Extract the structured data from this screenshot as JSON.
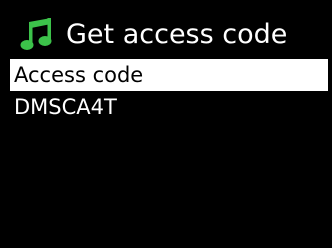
{
  "header": {
    "icon": "music-note-icon",
    "icon_color": "#3cc24a",
    "title": "Get access code"
  },
  "menu": {
    "items": [
      {
        "label": "Access code",
        "selected": true
      },
      {
        "label": "DMSCA4T",
        "selected": false
      }
    ]
  },
  "colors": {
    "background": "#000000",
    "text": "#ffffff",
    "selection_background": "#ffffff",
    "selection_text": "#000000"
  }
}
